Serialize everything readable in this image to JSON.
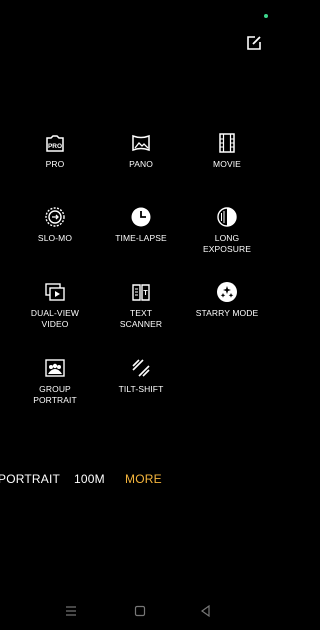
{
  "modes": [
    {
      "label": "PRO",
      "icon": "pro-icon"
    },
    {
      "label": "PANO",
      "icon": "panorama-icon"
    },
    {
      "label": "MOVIE",
      "icon": "film-icon"
    },
    {
      "label": "SLO-MO",
      "icon": "slow-motion-icon"
    },
    {
      "label": "TIME-LAPSE",
      "icon": "clock-icon"
    },
    {
      "label": "LONG\nEXPOSURE",
      "icon": "long-exposure-icon"
    },
    {
      "label": "DUAL-VIEW\nVIDEO",
      "icon": "dual-view-icon"
    },
    {
      "label": "TEXT\nSCANNER",
      "icon": "text-scanner-icon"
    },
    {
      "label": "STARRY MODE",
      "icon": "starry-icon"
    },
    {
      "label": "GROUP\nPORTRAIT",
      "icon": "group-portrait-icon"
    },
    {
      "label": "TILT-SHIFT",
      "icon": "tilt-shift-icon"
    }
  ],
  "bottom_tabs": [
    {
      "label": "PORTRAIT",
      "active": false
    },
    {
      "label": "100M",
      "active": false
    },
    {
      "label": "MORE",
      "active": true
    }
  ],
  "icons": {
    "status": "green-dot-indicator",
    "edit": "edit-icon",
    "nav": [
      "menu-icon",
      "home-icon",
      "back-icon"
    ]
  },
  "colors": {
    "background": "#000000",
    "text": "#ffffff",
    "active_tab": "#f5b53c",
    "indicator": "#3dd68c"
  }
}
